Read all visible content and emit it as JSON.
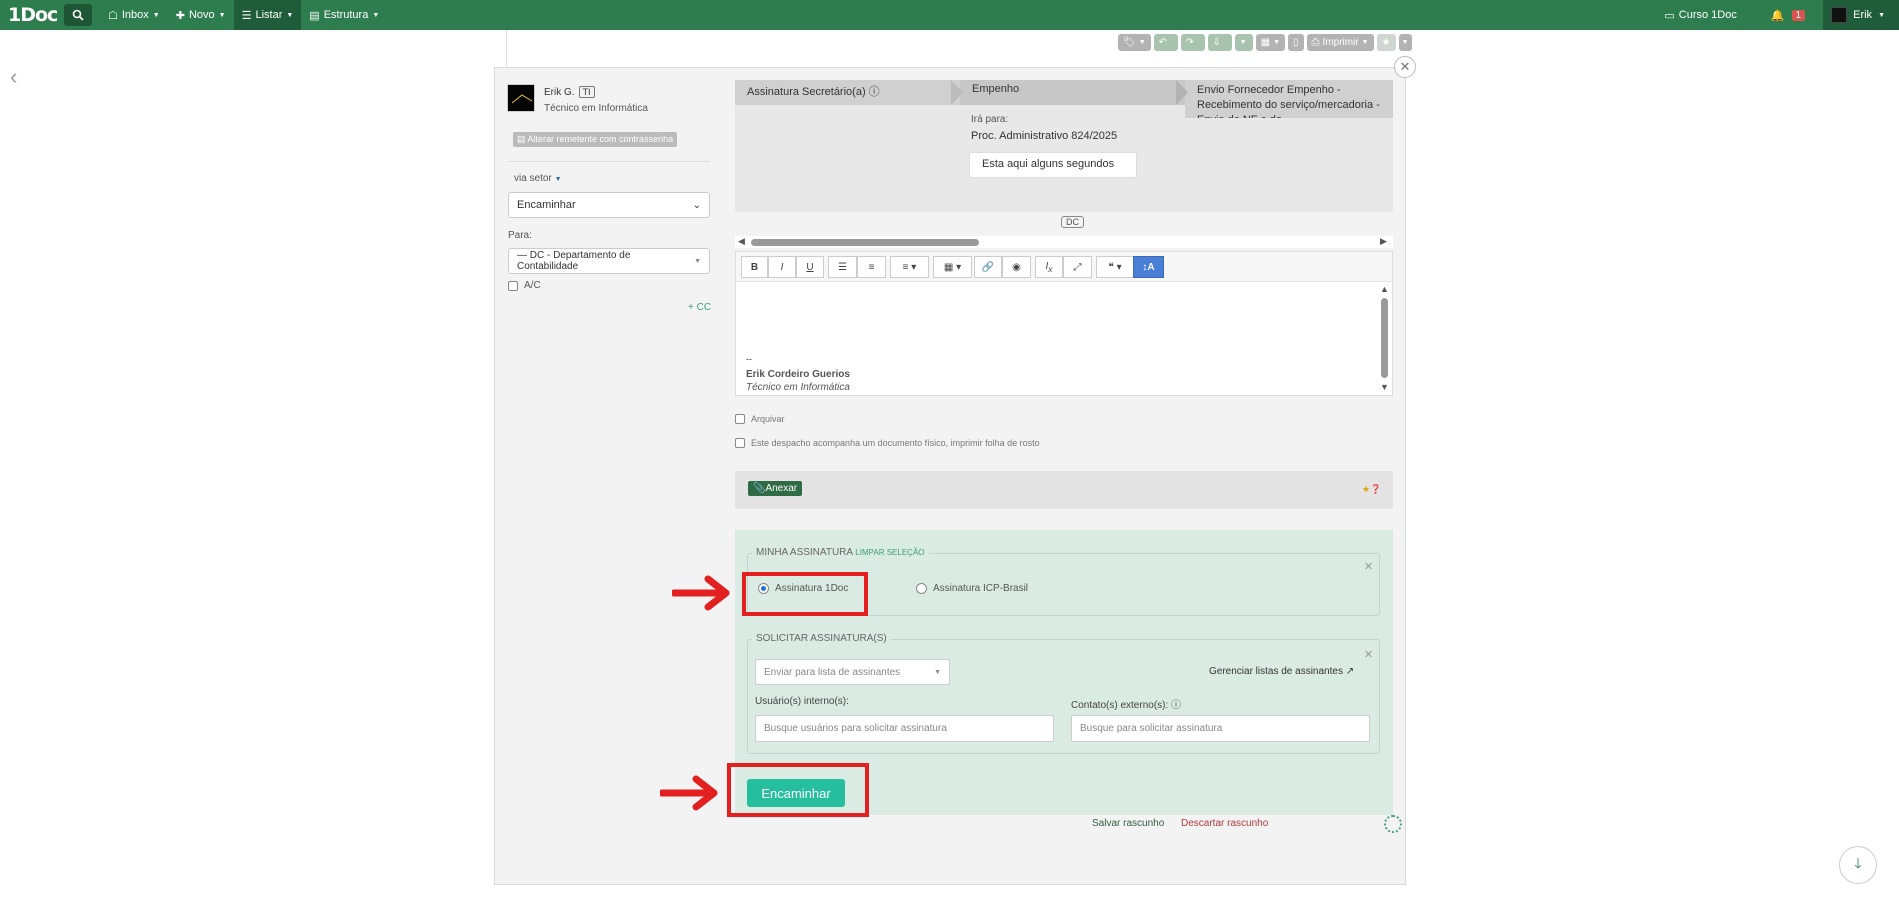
{
  "nav": {
    "logo": "1Doc",
    "items": [
      {
        "label": "Inbox",
        "icon": "inbox-icon"
      },
      {
        "label": "Novo",
        "icon": "plus-icon"
      },
      {
        "label": "Listar",
        "icon": "list-icon"
      },
      {
        "label": "Estrutura",
        "icon": "structure-icon"
      }
    ],
    "course_label": "Curso 1Doc",
    "notification_count": "1",
    "user_label": "Erik"
  },
  "toolbar": {
    "print_label": "Imprimir"
  },
  "sender": {
    "name": "Erik G.",
    "tag": "TI",
    "role": "Técnico em Informática",
    "change_sender_label": "Alterar remetente com contrassenha"
  },
  "routing": {
    "via_label": "via setor",
    "action_select": "Encaminhar",
    "para_label": "Para:",
    "para_value": "— DC - Departamento de Contabilidade",
    "ac_label": "A/C",
    "cc_link": "+ CC"
  },
  "flow": {
    "tabs": [
      "Assinatura Secretário(a)",
      "Empenho",
      "Envio Fornecedor Empenho - Recebimento do serviço/mercadoria - Envio de NF e do"
    ],
    "ira_para_label": "Irá para:",
    "process": "Proc. Administrativo 824/2025",
    "status_note": "Esta aqui alguns segundos",
    "dc_tag": "DC"
  },
  "editor": {
    "signature_dash": "--",
    "signature_name": "Erik Cordeiro Guerios",
    "signature_role": "Técnico em Informática"
  },
  "options": {
    "arquivar_label": "Arquivar",
    "fisico_label": "Este despacho acompanha um documento físico, imprimir folha de rosto"
  },
  "attach": {
    "anexar_label": "Anexar"
  },
  "signature": {
    "minha_legend": "MINHA ASSINATURA",
    "limpar_label": "LIMPAR SELEÇÃO",
    "option_1doc": "Assinatura 1Doc",
    "option_icp": "Assinatura ICP-Brasil",
    "solicitar_legend": "SOLICITAR ASSINATURA(S)",
    "lista_placeholder": "Enviar para lista de assinantes",
    "gerenciar_label": "Gerenciar listas de assinantes",
    "internos_label": "Usuário(s) interno(s):",
    "internos_placeholder": "Busque usuários para solicitar assinatura",
    "externos_label": "Contato(s) externo(s):",
    "externos_placeholder": "Busque para solicitar assinatura"
  },
  "actions": {
    "encaminhar_label": "Encaminhar",
    "salvar_label": "Salvar rascunho",
    "descartar_label": "Descartar rascunho"
  },
  "colors": {
    "nav_green": "#2e7d4f",
    "primary_teal": "#25bf9e",
    "highlight_red": "#e32020"
  }
}
